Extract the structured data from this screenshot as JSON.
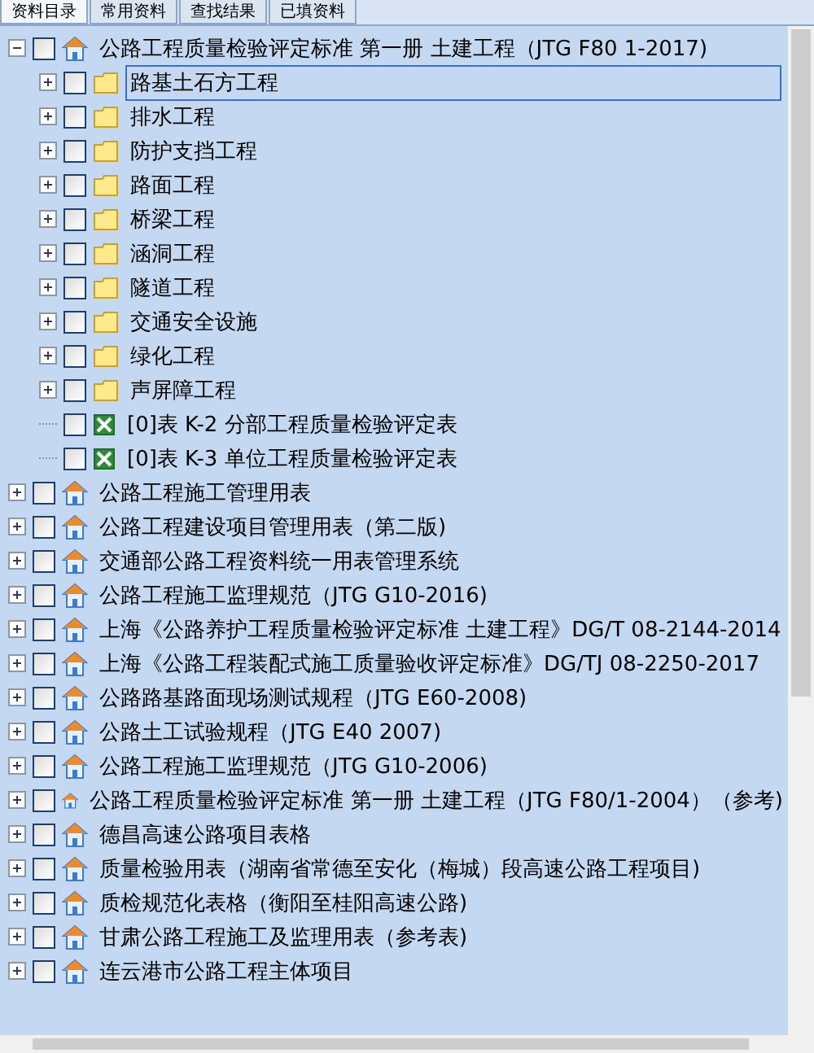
{
  "tabs": [
    {
      "label": "资料目录",
      "selected": true
    },
    {
      "label": "常用资料",
      "selected": false
    },
    {
      "label": "查找结果",
      "selected": false
    },
    {
      "label": "已填资料",
      "selected": false
    }
  ],
  "tree": [
    {
      "kind": "book",
      "label": "公路工程质量检验评定标准 第一册 土建工程（JTG F80 1-2017)",
      "checked": false,
      "expanded": true,
      "selected": false,
      "children": [
        {
          "kind": "folder",
          "label": "路基土石方工程",
          "checked": false,
          "expanded": false,
          "selected": true
        },
        {
          "kind": "folder",
          "label": "排水工程",
          "checked": false,
          "expanded": false,
          "selected": false
        },
        {
          "kind": "folder",
          "label": "防护支挡工程",
          "checked": false,
          "expanded": false,
          "selected": false
        },
        {
          "kind": "folder",
          "label": "路面工程",
          "checked": false,
          "expanded": false,
          "selected": false
        },
        {
          "kind": "folder",
          "label": "桥梁工程",
          "checked": false,
          "expanded": false,
          "selected": false
        },
        {
          "kind": "folder",
          "label": "涵洞工程",
          "checked": false,
          "expanded": false,
          "selected": false
        },
        {
          "kind": "folder",
          "label": "隧道工程",
          "checked": false,
          "expanded": false,
          "selected": false
        },
        {
          "kind": "folder",
          "label": "交通安全设施",
          "checked": false,
          "expanded": false,
          "selected": false
        },
        {
          "kind": "folder",
          "label": "绿化工程",
          "checked": false,
          "expanded": false,
          "selected": false
        },
        {
          "kind": "folder",
          "label": "声屏障工程",
          "checked": false,
          "expanded": false,
          "selected": false
        },
        {
          "kind": "sheet",
          "label": "[0]表 K-2  分部工程质量检验评定表",
          "checked": false,
          "selected": false
        },
        {
          "kind": "sheet",
          "label": "[0]表 K-3  单位工程质量检验评定表",
          "checked": false,
          "selected": false
        }
      ]
    },
    {
      "kind": "book",
      "label": "公路工程施工管理用表",
      "checked": false,
      "expanded": false,
      "selected": false
    },
    {
      "kind": "book",
      "label": "公路工程建设项目管理用表（第二版)",
      "checked": false,
      "expanded": false,
      "selected": false
    },
    {
      "kind": "book",
      "label": "交通部公路工程资料统一用表管理系统",
      "checked": false,
      "expanded": false,
      "selected": false
    },
    {
      "kind": "book",
      "label": "公路工程施工监理规范（JTG G10-2016)",
      "checked": false,
      "expanded": false,
      "selected": false
    },
    {
      "kind": "book",
      "label": "上海《公路养护工程质量检验评定标准 土建工程》DG/T 08-2144-2014",
      "checked": false,
      "expanded": false,
      "selected": false
    },
    {
      "kind": "book",
      "label": "上海《公路工程装配式施工质量验收评定标准》DG/TJ 08-2250-2017",
      "checked": false,
      "expanded": false,
      "selected": false
    },
    {
      "kind": "book",
      "label": "公路路基路面现场测试规程（JTG E60-2008)",
      "checked": false,
      "expanded": false,
      "selected": false
    },
    {
      "kind": "book",
      "label": "公路土工试验规程（JTG E40 2007)",
      "checked": false,
      "expanded": false,
      "selected": false
    },
    {
      "kind": "book",
      "label": "公路工程施工监理规范（JTG G10-2006)",
      "checked": false,
      "expanded": false,
      "selected": false
    },
    {
      "kind": "book",
      "label": "公路工程质量检验评定标准 第一册 土建工程（JTG F80/1-2004）（参考)",
      "checked": false,
      "expanded": false,
      "selected": false
    },
    {
      "kind": "book",
      "label": "德昌高速公路项目表格",
      "checked": false,
      "expanded": false,
      "selected": false
    },
    {
      "kind": "book",
      "label": "质量检验用表（湖南省常德至安化（梅城）段高速公路工程项目)",
      "checked": false,
      "expanded": false,
      "selected": false
    },
    {
      "kind": "book",
      "label": "质检规范化表格（衡阳至桂阳高速公路)",
      "checked": false,
      "expanded": false,
      "selected": false
    },
    {
      "kind": "book",
      "label": "甘肃公路工程施工及监理用表（参考表)",
      "checked": false,
      "expanded": false,
      "selected": false
    },
    {
      "kind": "book",
      "label": "连云港市公路工程主体项目",
      "checked": false,
      "expanded": false,
      "selected": false
    }
  ]
}
